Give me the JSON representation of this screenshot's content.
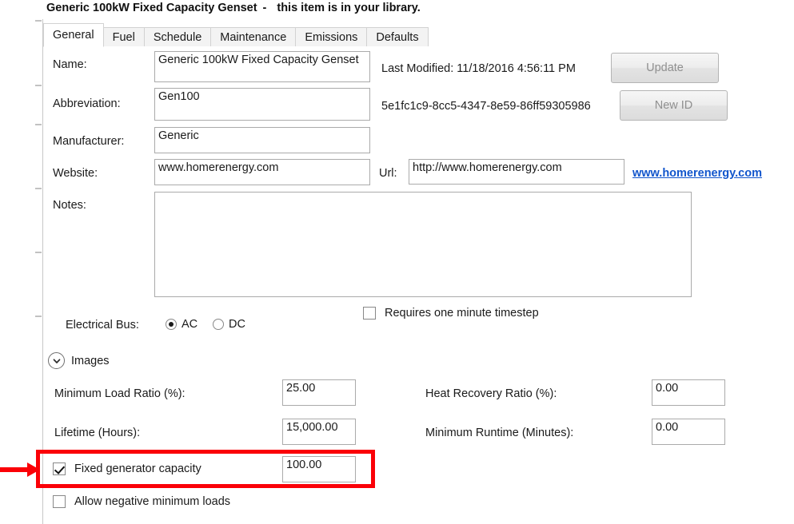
{
  "header": {
    "item_name": "Generic 100kW Fixed Capacity Genset",
    "separator": "-",
    "library_note": "this item is in your library."
  },
  "tabs": [
    {
      "label": "General",
      "active": true
    },
    {
      "label": "Fuel",
      "active": false
    },
    {
      "label": "Schedule",
      "active": false
    },
    {
      "label": "Maintenance",
      "active": false
    },
    {
      "label": "Emissions",
      "active": false
    },
    {
      "label": "Defaults",
      "active": false
    }
  ],
  "general": {
    "name_label": "Name:",
    "name_value": "Generic 100kW Fixed Capacity Genset",
    "abbreviation_label": "Abbreviation:",
    "abbreviation_value": "Gen100",
    "manufacturer_label": "Manufacturer:",
    "manufacturer_value": "Generic",
    "website_label": "Website:",
    "website_value": "www.homerenergy.com",
    "url_label": "Url:",
    "url_value": "http://www.homerenergy.com",
    "url_link_text": "www.homerenergy.com",
    "notes_label": "Notes:",
    "notes_value": "",
    "last_modified": "Last Modified: 11/18/2016 4:56:11 PM",
    "guid": "5e1fc1c9-8cc5-4347-8e59-86ff59305986",
    "update_button": "Update",
    "new_id_button": "New ID"
  },
  "electrical_bus": {
    "label": "Electrical Bus:",
    "options": [
      {
        "label": "AC",
        "selected": true
      },
      {
        "label": "DC",
        "selected": false
      }
    ]
  },
  "timestep": {
    "label": "Requires one minute timestep",
    "checked": false
  },
  "images_section": {
    "label": "Images",
    "expanded": false,
    "icon": "chevron-down-circle-icon"
  },
  "parameters": {
    "min_load_ratio_label": "Minimum Load Ratio (%):",
    "min_load_ratio_value": "25.00",
    "lifetime_label": "Lifetime (Hours):",
    "lifetime_value": "15,000.00",
    "heat_recovery_label": "Heat Recovery Ratio (%):",
    "heat_recovery_value": "0.00",
    "min_runtime_label": "Minimum Runtime (Minutes):",
    "min_runtime_value": "0.00",
    "fixed_capacity_label": "Fixed generator capacity",
    "fixed_capacity_checked": true,
    "fixed_capacity_value": "100.00",
    "allow_negative_label": "Allow negative minimum loads",
    "allow_negative_checked": false
  },
  "annotation": {
    "highlight_color": "#fb0007",
    "arrow_color": "#fb0007",
    "target": "fixed-generator-capacity-row"
  }
}
